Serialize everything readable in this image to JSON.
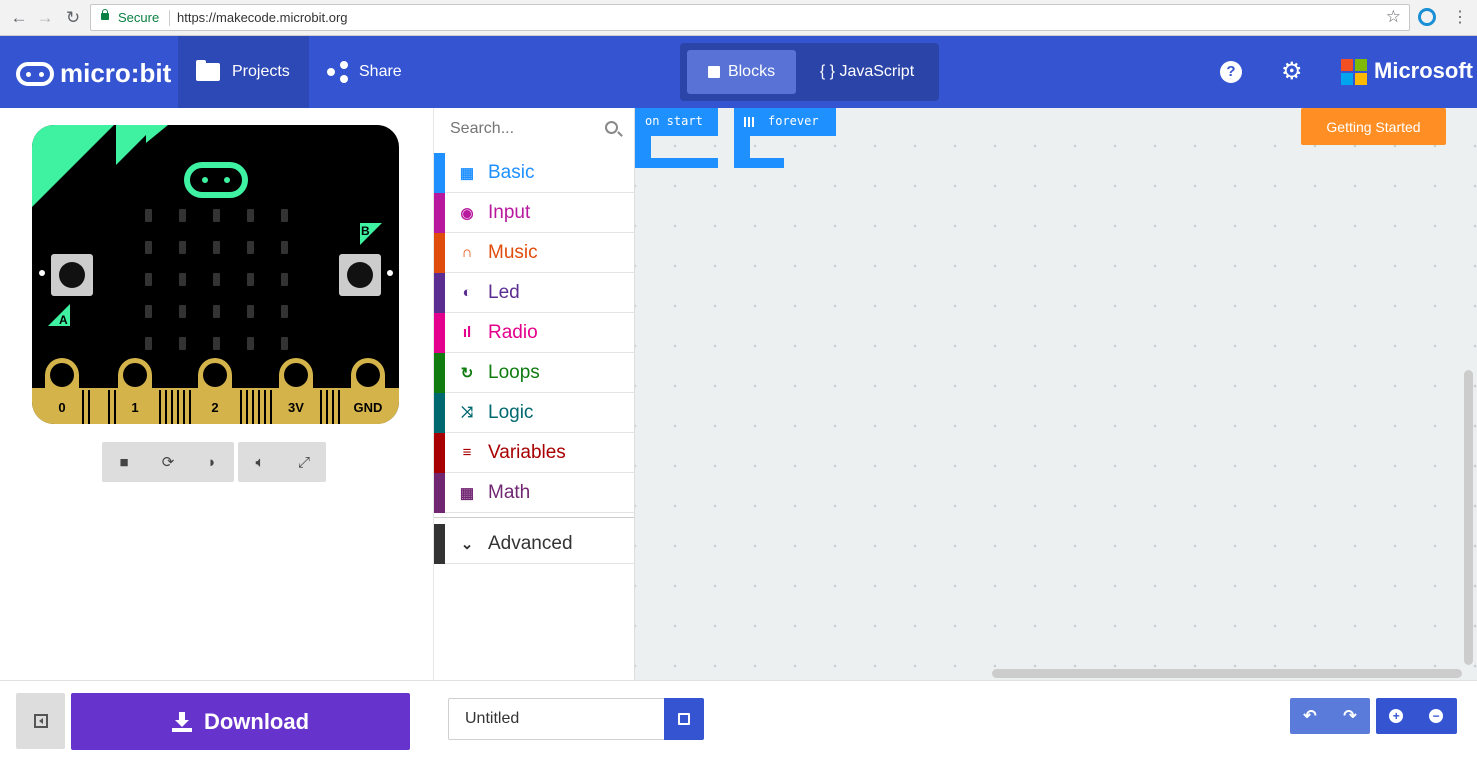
{
  "browser": {
    "secure_label": "Secure",
    "url": "https://makecode.microbit.org"
  },
  "header": {
    "logo_text": "micro:bit",
    "projects_label": "Projects",
    "share_label": "Share",
    "blocks_label": "Blocks",
    "javascript_label": "{ } JavaScript",
    "help_icon": "?",
    "microsoft_label": "Microsoft"
  },
  "simulator": {
    "button_a": "A",
    "button_b": "B",
    "pins": [
      "0",
      "1",
      "2",
      "3V",
      "GND"
    ],
    "controls": [
      "stop-icon",
      "restart-icon",
      "slow-motion-icon",
      "mute-icon",
      "fullscreen-icon"
    ]
  },
  "toolbox": {
    "search_placeholder": "Search...",
    "categories": [
      {
        "label": "Basic",
        "color": "#1e90ff",
        "icon": "grid-icon"
      },
      {
        "label": "Input",
        "color": "#b8189e",
        "icon": "target-icon"
      },
      {
        "label": "Music",
        "color": "#e04c0c",
        "icon": "headphones-icon"
      },
      {
        "label": "Led",
        "color": "#5c2d91",
        "icon": "toggle-icon"
      },
      {
        "label": "Radio",
        "color": "#e3008c",
        "icon": "signal-icon"
      },
      {
        "label": "Loops",
        "color": "#107c10",
        "icon": "refresh-icon"
      },
      {
        "label": "Logic",
        "color": "#006970",
        "icon": "shuffle-icon"
      },
      {
        "label": "Variables",
        "color": "#a80000",
        "icon": "bars-icon"
      },
      {
        "label": "Math",
        "color": "#712672",
        "icon": "calculator-icon"
      }
    ],
    "advanced_label": "Advanced"
  },
  "workspace": {
    "on_start_label": "on start",
    "forever_label": "forever",
    "getting_started_label": "Getting Started"
  },
  "footer": {
    "download_label": "Download",
    "project_name": "Untitled"
  },
  "colors": {
    "header": "#3454d1",
    "download": "#6633cc",
    "getting_started": "#ff8f25",
    "accent_green": "#3ff2a2"
  }
}
